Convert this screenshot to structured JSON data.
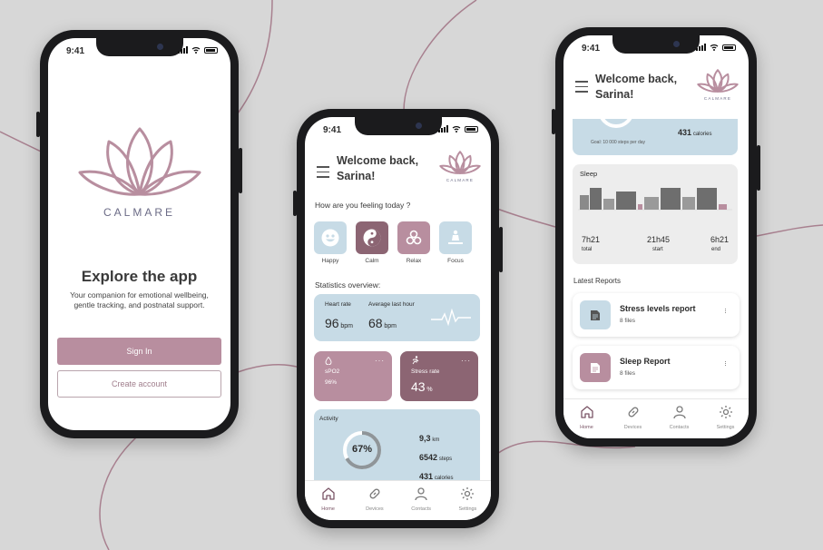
{
  "status": {
    "time": "9:41"
  },
  "brand": {
    "name": "CALMARE",
    "accent": "#b88e9f",
    "mauve": "#8c6573",
    "blue": "#c7dbe6"
  },
  "onboarding": {
    "title": "Explore the app",
    "description": "Your companion for emotional wellbeing, gentle tracking, and postnatal support.",
    "sign_in_label": "Sign In",
    "create_account_label": "Create account"
  },
  "home": {
    "welcome_line1": "Welcome back,",
    "welcome_line2": "Sarina!",
    "feeling_question": "How are you feeling today ?",
    "moods": [
      {
        "label": "Happy",
        "icon": "smiley-icon"
      },
      {
        "label": "Calm",
        "icon": "yin-yang-icon"
      },
      {
        "label": "Relax",
        "icon": "spiral-icon"
      },
      {
        "label": "Focus",
        "icon": "meditation-icon"
      }
    ],
    "stats_title": "Statistics overview:",
    "heart_rate_label": "Heart rate",
    "heart_rate_value": "96",
    "heart_rate_unit": "bpm",
    "avg_label": "Average last hour",
    "avg_value": "68",
    "avg_unit": "bpm",
    "spo2_label": "sPO2",
    "spo2_value": "96%",
    "stress_label": "Stress rate",
    "stress_value": "43",
    "stress_unit": "%",
    "activity_label": "Activity",
    "activity_percent": "67%",
    "activity_progress": 0.67,
    "distance_value": "9,3",
    "distance_unit": "km",
    "steps_value": "6542",
    "steps_unit": "steps",
    "calories_value": "431",
    "calories_unit": "calories"
  },
  "nav": {
    "home": "Home",
    "devices": "Devices",
    "contacts": "Contacts",
    "settings": "Settings"
  },
  "dashboard": {
    "goal_text": "Goal: 10 000 steps per day",
    "calories_value": "431",
    "calories_unit": "calories",
    "sleep_title": "Sleep",
    "sleep_total_value": "7h21",
    "sleep_total_label": "total",
    "sleep_start_value": "21h45",
    "sleep_start_label": "start",
    "sleep_end_value": "6h21",
    "sleep_end_label": "end",
    "reports_title": "Latest Reports",
    "reports": [
      {
        "title": "Stress levels report",
        "subtitle": "8 files"
      },
      {
        "title": "Sleep Report",
        "subtitle": "8 files"
      }
    ]
  }
}
